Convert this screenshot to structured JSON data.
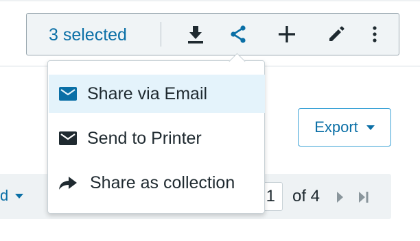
{
  "toolbar": {
    "selected_label": "3 selected",
    "actions": {
      "download": "download-icon",
      "share": "share-icon",
      "add": "plus-icon",
      "edit": "pencil-icon",
      "more": "more-vertical-icon"
    }
  },
  "share_menu": {
    "items": [
      {
        "label": "Share via Email",
        "icon": "mail-icon",
        "active": true
      },
      {
        "label": "Send to Printer",
        "icon": "mail-icon",
        "active": false
      },
      {
        "label": "Share as collection",
        "icon": "share-arrow-icon",
        "active": false
      }
    ]
  },
  "export": {
    "label": "Export"
  },
  "pager": {
    "sort_label_fragment": "d",
    "current_page": "1",
    "total_label": "of 4"
  },
  "colors": {
    "accent": "#0a6fa6",
    "accent_border": "#3aa1d6",
    "icon_dark": "#1f2a30",
    "toolbar_bg": "#f0f4f6",
    "menu_active_bg": "#e4f3fb",
    "pager_bg": "#eef2f4",
    "pager_disabled": "#8a969c"
  }
}
